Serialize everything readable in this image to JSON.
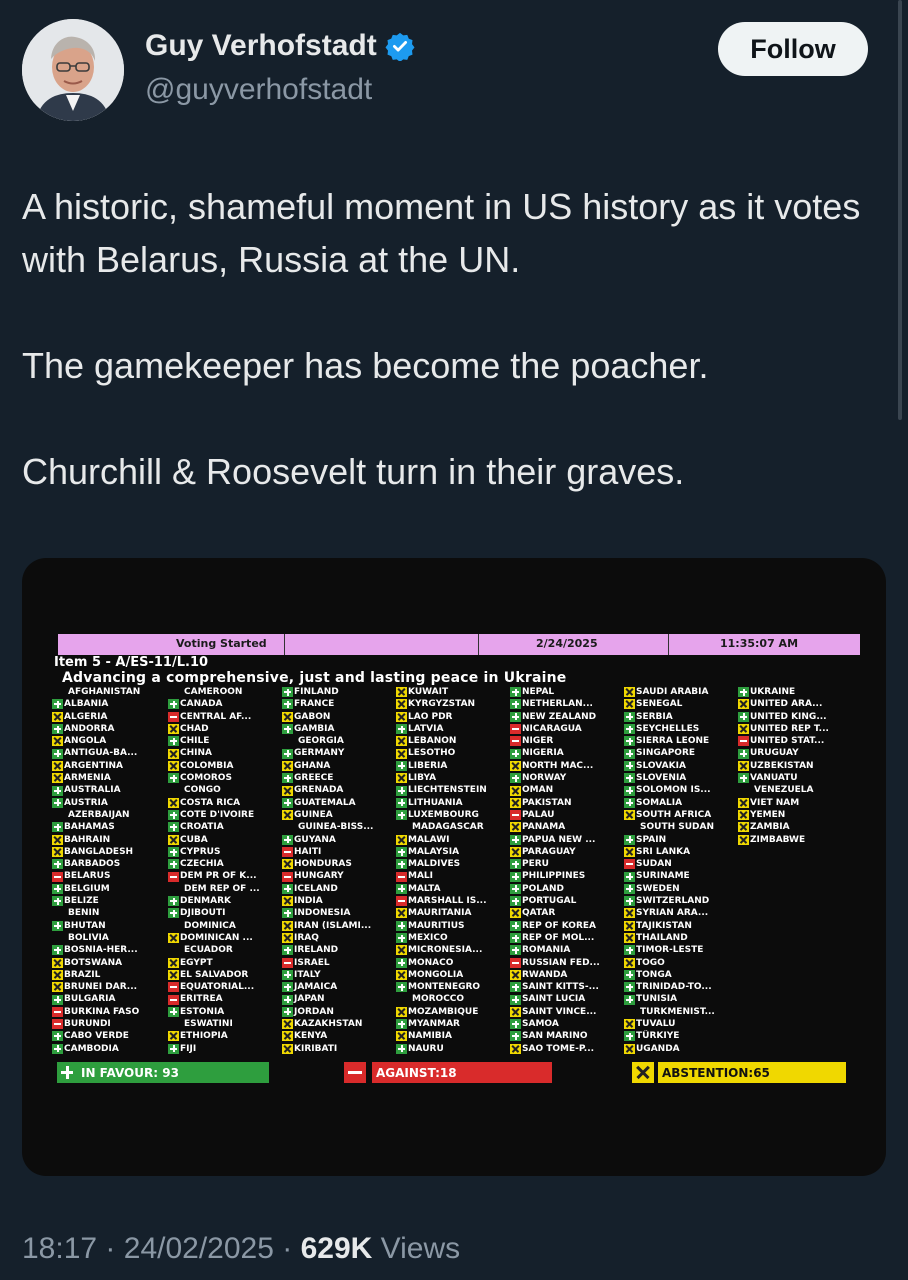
{
  "author": {
    "name": "Guy Verhofstadt",
    "handle": "@guyverhofstadt",
    "follow_label": "Follow"
  },
  "tweet": {
    "paragraphs": [
      "A historic, shameful moment in US history as it votes with Belarus, Russia at the UN.",
      "The gamekeeper has become the poacher.",
      "Churchill & Roosevelt turn in their graves."
    ]
  },
  "board": {
    "status": "Voting Started",
    "date": "2/24/2025",
    "time": "11:35:07 AM",
    "item": "Item 5 - A/ES-11/L.10",
    "title": "Advancing a comprehensive, just and lasting peace in Ukraine",
    "columns": [
      [
        [
          "n",
          "AFGHANISTAN"
        ],
        [
          "y",
          "ALBANIA"
        ],
        [
          "a",
          "ALGERIA"
        ],
        [
          "y",
          "ANDORRA"
        ],
        [
          "a",
          "ANGOLA"
        ],
        [
          "y",
          "ANTIGUA-BA..."
        ],
        [
          "a",
          "ARGENTINA"
        ],
        [
          "a",
          "ARMENIA"
        ],
        [
          "y",
          "AUSTRALIA"
        ],
        [
          "y",
          "AUSTRIA"
        ],
        [
          "n",
          "AZERBAIJAN"
        ],
        [
          "y",
          "BAHAMAS"
        ],
        [
          "a",
          "BAHRAIN"
        ],
        [
          "a",
          "BANGLADESH"
        ],
        [
          "y",
          "BARBADOS"
        ],
        [
          "r",
          "BELARUS"
        ],
        [
          "y",
          "BELGIUM"
        ],
        [
          "y",
          "BELIZE"
        ],
        [
          "n",
          "BENIN"
        ],
        [
          "y",
          "BHUTAN"
        ],
        [
          "n",
          "BOLIVIA"
        ],
        [
          "y",
          "BOSNIA-HER..."
        ],
        [
          "a",
          "BOTSWANA"
        ],
        [
          "a",
          "BRAZIL"
        ],
        [
          "a",
          "BRUNEI DAR..."
        ],
        [
          "y",
          "BULGARIA"
        ],
        [
          "r",
          "BURKINA FASO"
        ],
        [
          "r",
          "BURUNDI"
        ],
        [
          "y",
          "CABO VERDE"
        ],
        [
          "y",
          "CAMBODIA"
        ]
      ],
      [
        [
          "n",
          "CAMEROON"
        ],
        [
          "y",
          "CANADA"
        ],
        [
          "r",
          "CENTRAL AF..."
        ],
        [
          "a",
          "CHAD"
        ],
        [
          "y",
          "CHILE"
        ],
        [
          "a",
          "CHINA"
        ],
        [
          "a",
          "COLOMBIA"
        ],
        [
          "y",
          "COMOROS"
        ],
        [
          "n",
          "CONGO"
        ],
        [
          "a",
          "COSTA RICA"
        ],
        [
          "y",
          "COTE D'IVOIRE"
        ],
        [
          "y",
          "CROATIA"
        ],
        [
          "a",
          "CUBA"
        ],
        [
          "y",
          "CYPRUS"
        ],
        [
          "y",
          "CZECHIA"
        ],
        [
          "r",
          "DEM PR OF K..."
        ],
        [
          "n",
          "DEM REP OF ..."
        ],
        [
          "y",
          "DENMARK"
        ],
        [
          "y",
          "DJIBOUTI"
        ],
        [
          "n",
          "DOMINICA"
        ],
        [
          "a",
          "DOMINICAN ..."
        ],
        [
          "n",
          "ECUADOR"
        ],
        [
          "a",
          "EGYPT"
        ],
        [
          "a",
          "EL SALVADOR"
        ],
        [
          "r",
          "EQUATORIAL..."
        ],
        [
          "r",
          "ERITREA"
        ],
        [
          "y",
          "ESTONIA"
        ],
        [
          "n",
          "ESWATINI"
        ],
        [
          "a",
          "ETHIOPIA"
        ],
        [
          "y",
          "FIJI"
        ]
      ],
      [
        [
          "y",
          "FINLAND"
        ],
        [
          "y",
          "FRANCE"
        ],
        [
          "a",
          "GABON"
        ],
        [
          "y",
          "GAMBIA"
        ],
        [
          "n",
          "GEORGIA"
        ],
        [
          "y",
          "GERMANY"
        ],
        [
          "a",
          "GHANA"
        ],
        [
          "y",
          "GREECE"
        ],
        [
          "a",
          "GRENADA"
        ],
        [
          "y",
          "GUATEMALA"
        ],
        [
          "a",
          "GUINEA"
        ],
        [
          "n",
          "GUINEA-BISS..."
        ],
        [
          "y",
          "GUYANA"
        ],
        [
          "r",
          "HAITI"
        ],
        [
          "a",
          "HONDURAS"
        ],
        [
          "r",
          "HUNGARY"
        ],
        [
          "y",
          "ICELAND"
        ],
        [
          "a",
          "INDIA"
        ],
        [
          "y",
          "INDONESIA"
        ],
        [
          "a",
          "IRAN (ISLAMI..."
        ],
        [
          "a",
          "IRAQ"
        ],
        [
          "y",
          "IRELAND"
        ],
        [
          "r",
          "ISRAEL"
        ],
        [
          "y",
          "ITALY"
        ],
        [
          "y",
          "JAMAICA"
        ],
        [
          "y",
          "JAPAN"
        ],
        [
          "y",
          "JORDAN"
        ],
        [
          "a",
          "KAZAKHSTAN"
        ],
        [
          "a",
          "KENYA"
        ],
        [
          "a",
          "KIRIBATI"
        ]
      ],
      [
        [
          "a",
          "KUWAIT"
        ],
        [
          "a",
          "KYRGYZSTAN"
        ],
        [
          "a",
          "LAO PDR"
        ],
        [
          "y",
          "LATVIA"
        ],
        [
          "a",
          "LEBANON"
        ],
        [
          "a",
          "LESOTHO"
        ],
        [
          "y",
          "LIBERIA"
        ],
        [
          "a",
          "LIBYA"
        ],
        [
          "y",
          "LIECHTENSTEIN"
        ],
        [
          "y",
          "LITHUANIA"
        ],
        [
          "y",
          "LUXEMBOURG"
        ],
        [
          "n",
          "MADAGASCAR"
        ],
        [
          "a",
          "MALAWI"
        ],
        [
          "y",
          "MALAYSIA"
        ],
        [
          "y",
          "MALDIVES"
        ],
        [
          "r",
          "MALI"
        ],
        [
          "y",
          "MALTA"
        ],
        [
          "r",
          "MARSHALL IS..."
        ],
        [
          "a",
          "MAURITANIA"
        ],
        [
          "y",
          "MAURITIUS"
        ],
        [
          "y",
          "MEXICO"
        ],
        [
          "a",
          "MICRONESIA..."
        ],
        [
          "y",
          "MONACO"
        ],
        [
          "a",
          "MONGOLIA"
        ],
        [
          "y",
          "MONTENEGRO"
        ],
        [
          "n",
          "MOROCCO"
        ],
        [
          "a",
          "MOZAMBIQUE"
        ],
        [
          "y",
          "MYANMAR"
        ],
        [
          "a",
          "NAMIBIA"
        ],
        [
          "y",
          "NAURU"
        ]
      ],
      [
        [
          "y",
          "NEPAL"
        ],
        [
          "y",
          "NETHERLAN..."
        ],
        [
          "y",
          "NEW ZEALAND"
        ],
        [
          "r",
          "NICARAGUA"
        ],
        [
          "r",
          "NIGER"
        ],
        [
          "y",
          "NIGERIA"
        ],
        [
          "a",
          "NORTH MAC..."
        ],
        [
          "y",
          "NORWAY"
        ],
        [
          "a",
          "OMAN"
        ],
        [
          "a",
          "PAKISTAN"
        ],
        [
          "r",
          "PALAU"
        ],
        [
          "a",
          "PANAMA"
        ],
        [
          "y",
          "PAPUA NEW ..."
        ],
        [
          "a",
          "PARAGUAY"
        ],
        [
          "y",
          "PERU"
        ],
        [
          "y",
          "PHILIPPINES"
        ],
        [
          "y",
          "POLAND"
        ],
        [
          "y",
          "PORTUGAL"
        ],
        [
          "a",
          "QATAR"
        ],
        [
          "y",
          "REP OF KOREA"
        ],
        [
          "y",
          "REP OF MOL..."
        ],
        [
          "y",
          "ROMANIA"
        ],
        [
          "r",
          "RUSSIAN FED..."
        ],
        [
          "a",
          "RWANDA"
        ],
        [
          "y",
          "SAINT KITTS-..."
        ],
        [
          "y",
          "SAINT LUCIA"
        ],
        [
          "a",
          "SAINT VINCE..."
        ],
        [
          "y",
          "SAMOA"
        ],
        [
          "y",
          "SAN MARINO"
        ],
        [
          "a",
          "SAO TOME-P..."
        ]
      ],
      [
        [
          "a",
          "SAUDI ARABIA"
        ],
        [
          "a",
          "SENEGAL"
        ],
        [
          "y",
          "SERBIA"
        ],
        [
          "y",
          "SEYCHELLES"
        ],
        [
          "y",
          "SIERRA LEONE"
        ],
        [
          "y",
          "SINGAPORE"
        ],
        [
          "y",
          "SLOVAKIA"
        ],
        [
          "y",
          "SLOVENIA"
        ],
        [
          "y",
          "SOLOMON IS..."
        ],
        [
          "y",
          "SOMALIA"
        ],
        [
          "a",
          "SOUTH AFRICA"
        ],
        [
          "n",
          "SOUTH SUDAN"
        ],
        [
          "y",
          "SPAIN"
        ],
        [
          "a",
          "SRI LANKA"
        ],
        [
          "r",
          "SUDAN"
        ],
        [
          "y",
          "SURINAME"
        ],
        [
          "y",
          "SWEDEN"
        ],
        [
          "y",
          "SWITZERLAND"
        ],
        [
          "a",
          "SYRIAN ARA..."
        ],
        [
          "a",
          "TAJIKISTAN"
        ],
        [
          "a",
          "THAILAND"
        ],
        [
          "y",
          "TIMOR-LESTE"
        ],
        [
          "a",
          "TOGO"
        ],
        [
          "y",
          "TONGA"
        ],
        [
          "y",
          "TRINIDAD-TO..."
        ],
        [
          "y",
          "TUNISIA"
        ],
        [
          "n",
          "TURKMENIST..."
        ],
        [
          "a",
          "TUVALU"
        ],
        [
          "y",
          "TÜRKIYE"
        ],
        [
          "a",
          "UGANDA"
        ]
      ],
      [
        [
          "y",
          "UKRAINE"
        ],
        [
          "a",
          "UNITED ARA..."
        ],
        [
          "y",
          "UNITED KING..."
        ],
        [
          "a",
          "UNITED REP T..."
        ],
        [
          "r",
          "UNITED STAT..."
        ],
        [
          "y",
          "URUGUAY"
        ],
        [
          "a",
          "UZBEKISTAN"
        ],
        [
          "y",
          "VANUATU"
        ],
        [
          "n",
          "VENEZUELA"
        ],
        [
          "a",
          "VIET NAM"
        ],
        [
          "a",
          "YEMEN"
        ],
        [
          "a",
          "ZAMBIA"
        ],
        [
          "a",
          "ZIMBABWE"
        ]
      ]
    ],
    "totals": {
      "favour": "IN FAVOUR: 93",
      "against": "AGAINST:18",
      "abstention": "ABSTENTION:65"
    }
  },
  "meta": {
    "time": "18:17",
    "date": "24/02/2025",
    "views_count": "629K",
    "views_label": "Views",
    "separator": "·"
  }
}
